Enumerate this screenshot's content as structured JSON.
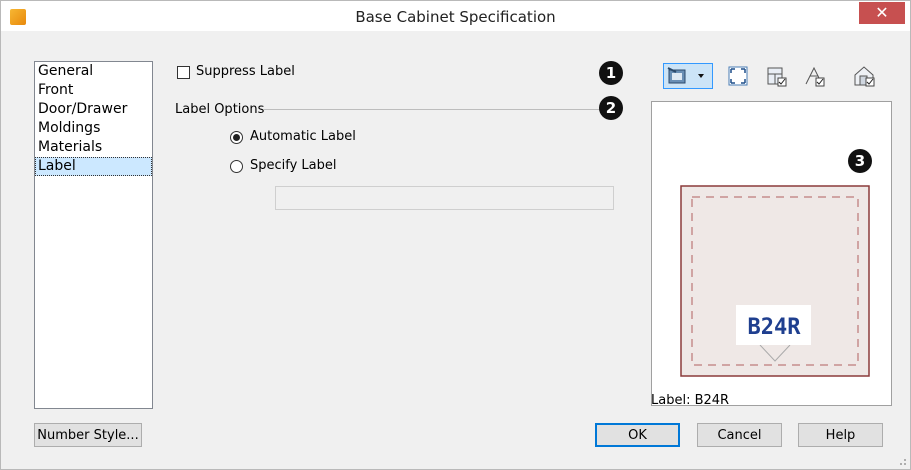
{
  "window": {
    "title": "Base Cabinet Specification",
    "close_glyph": "✕"
  },
  "nav": {
    "items": [
      {
        "label": "General"
      },
      {
        "label": "Front"
      },
      {
        "label": "Door/Drawer"
      },
      {
        "label": "Moldings"
      },
      {
        "label": "Materials"
      },
      {
        "label": "Label",
        "selected": true
      }
    ]
  },
  "panel": {
    "suppress_label": {
      "label": "Suppress Label",
      "checked": false
    },
    "label_options": {
      "title": "Label Options",
      "options": [
        {
          "label": "Automatic Label",
          "selected": true
        },
        {
          "label": "Specify Label",
          "selected": false
        }
      ],
      "specify_value": ""
    }
  },
  "callouts": [
    "1",
    "2",
    "3"
  ],
  "toolbar": {
    "icons": [
      "camera-view-dropdown-icon",
      "fill-window-icon",
      "cabinet-view-icon",
      "plan-view-icon",
      "elevation-view-icon"
    ],
    "active": "camera-view-dropdown-icon"
  },
  "preview": {
    "cabinet_label": "B24R"
  },
  "status": {
    "label_text": "Label:  B24R"
  },
  "buttons": {
    "number_style": "Number Style...",
    "ok": "OK",
    "cancel": "Cancel",
    "help": "Help"
  },
  "colors": {
    "close_button": "#c75050",
    "selection": "#cce8ff",
    "cabinet_outline": "#8b3a3a",
    "label_text": "#1f3f8f",
    "default_button_border": "#0078d7"
  }
}
